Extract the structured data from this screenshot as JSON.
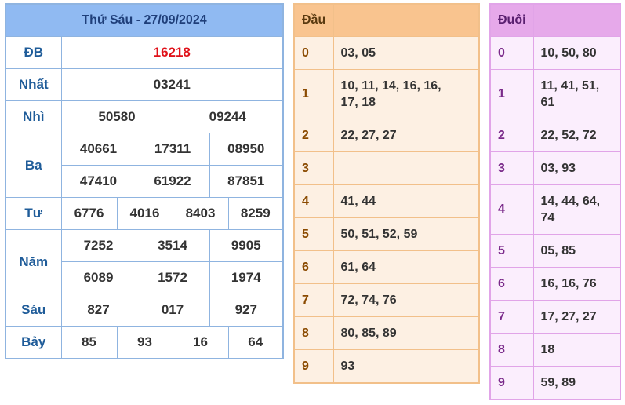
{
  "results": {
    "title": "Thứ Sáu - 27/09/2024",
    "rows": {
      "db": {
        "label": "ĐB",
        "values": [
          "16218"
        ]
      },
      "nhat": {
        "label": "Nhất",
        "values": [
          "03241"
        ]
      },
      "nhi": {
        "label": "Nhì",
        "values": [
          "50580",
          "09244"
        ]
      },
      "ba": {
        "label": "Ba",
        "values": [
          "40661",
          "17311",
          "08950",
          "47410",
          "61922",
          "87851"
        ]
      },
      "tu": {
        "label": "Tư",
        "values": [
          "6776",
          "4016",
          "8403",
          "8259"
        ]
      },
      "nam": {
        "label": "Năm",
        "values": [
          "7252",
          "3514",
          "9905",
          "6089",
          "1572",
          "1974"
        ]
      },
      "sau": {
        "label": "Sáu",
        "values": [
          "827",
          "017",
          "927"
        ]
      },
      "bay": {
        "label": "Bảy",
        "values": [
          "85",
          "93",
          "16",
          "64"
        ]
      }
    }
  },
  "dau": {
    "header": "Đầu",
    "rows": [
      {
        "key": "0",
        "values": "03, 05"
      },
      {
        "key": "1",
        "values": "10, 11, 14, 16, 16, 17, 18"
      },
      {
        "key": "2",
        "values": "22, 27, 27"
      },
      {
        "key": "3",
        "values": ""
      },
      {
        "key": "4",
        "values": "41, 44"
      },
      {
        "key": "5",
        "values": "50, 51, 52, 59"
      },
      {
        "key": "6",
        "values": "61, 64"
      },
      {
        "key": "7",
        "values": "72, 74, 76"
      },
      {
        "key": "8",
        "values": "80, 85, 89"
      },
      {
        "key": "9",
        "values": "93"
      }
    ]
  },
  "duoi": {
    "header": "Đuôi",
    "rows": [
      {
        "key": "0",
        "values": "10, 50, 80"
      },
      {
        "key": "1",
        "values": "11, 41, 51, 61"
      },
      {
        "key": "2",
        "values": "22, 52, 72"
      },
      {
        "key": "3",
        "values": "03, 93"
      },
      {
        "key": "4",
        "values": "14, 44, 64, 74"
      },
      {
        "key": "5",
        "values": "05, 85"
      },
      {
        "key": "6",
        "values": "16, 16, 76"
      },
      {
        "key": "7",
        "values": "17, 27, 27"
      },
      {
        "key": "8",
        "values": "18"
      },
      {
        "key": "9",
        "values": "59, 89"
      }
    ]
  }
}
